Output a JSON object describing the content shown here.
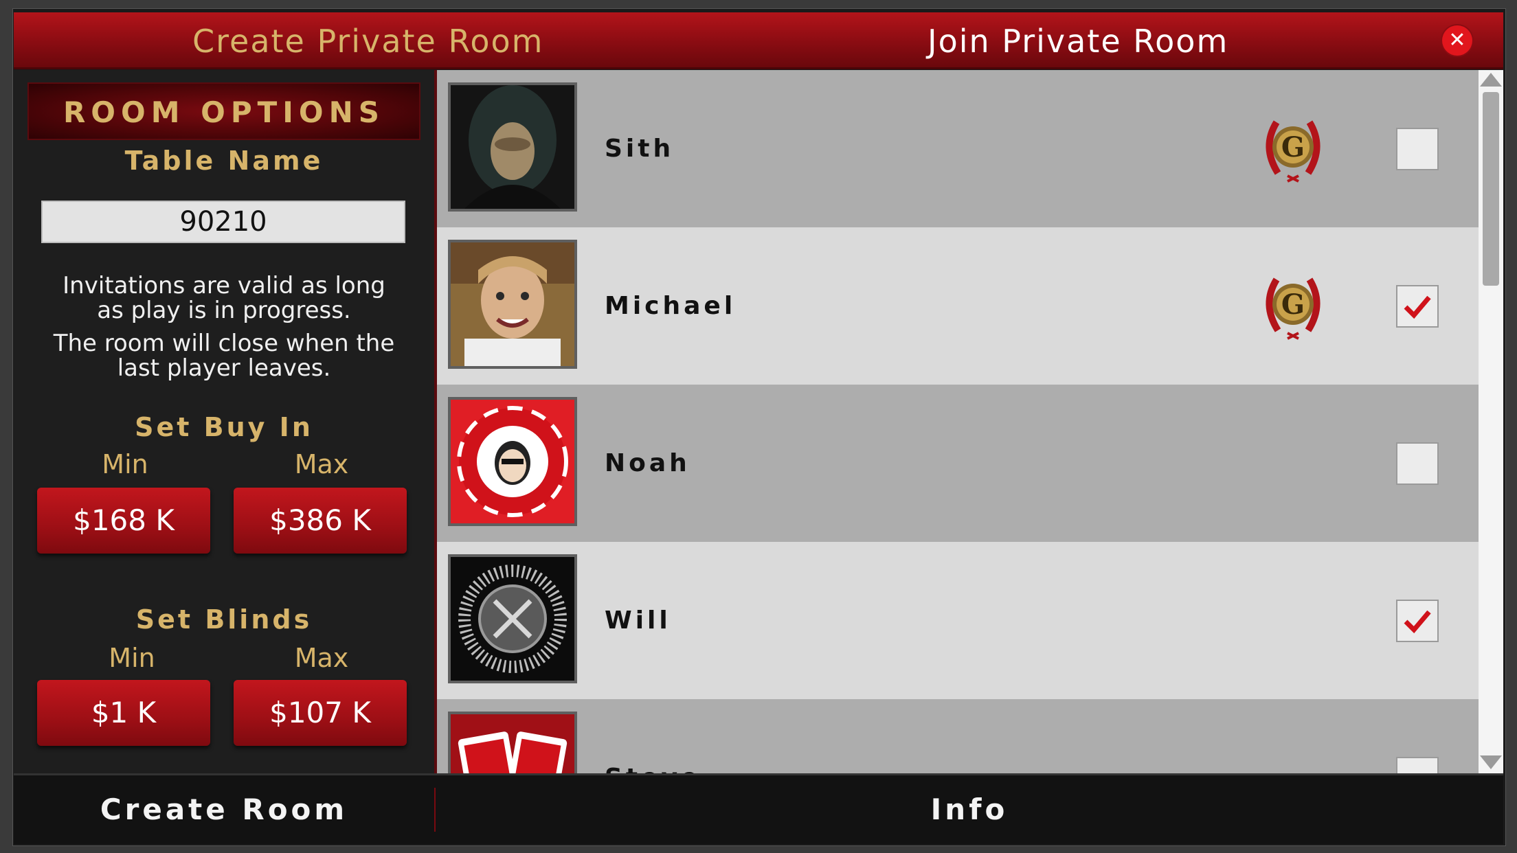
{
  "header": {
    "create_tab": "Create Private Room",
    "join_tab": "Join Private Room",
    "close_icon": "close-icon"
  },
  "room_options": {
    "banner": "ROOM OPTIONS",
    "table_name_label": "Table Name",
    "table_name_value": "90210",
    "info_line1": "Invitations are valid as long",
    "info_line2": "as play is in progress.",
    "info_line3": "The room will close when the",
    "info_line4": "last player leaves.",
    "buy_in_label": "Set Buy In",
    "buy_in_min_label": "Min",
    "buy_in_max_label": "Max",
    "buy_in_min": "$168 K",
    "buy_in_max": "$386 K",
    "blinds_label": "Set Blinds",
    "blinds_min_label": "Min",
    "blinds_max_label": "Max",
    "blinds_min": "$1 K",
    "blinds_max": "$107 K"
  },
  "players": [
    {
      "name": "Sith",
      "avatar": "hooded-figure-avatar",
      "badge": "g-laurel-badge",
      "checked": false
    },
    {
      "name": "Michael",
      "avatar": "smiling-man-avatar",
      "badge": "g-laurel-badge",
      "checked": true
    },
    {
      "name": "Noah",
      "avatar": "el-patron-chip-avatar",
      "badge": "",
      "checked": false
    },
    {
      "name": "Will",
      "avatar": "spiked-emblem-avatar",
      "badge": "",
      "checked": true
    },
    {
      "name": "Steve",
      "avatar": "el-patron-cards-avatar",
      "badge": "",
      "checked": false
    }
  ],
  "footer": {
    "create_room": "Create Room",
    "info": "Info"
  },
  "colors": {
    "accent_red": "#b3141a",
    "gold": "#d7b46a",
    "check_red": "#d0121a"
  }
}
